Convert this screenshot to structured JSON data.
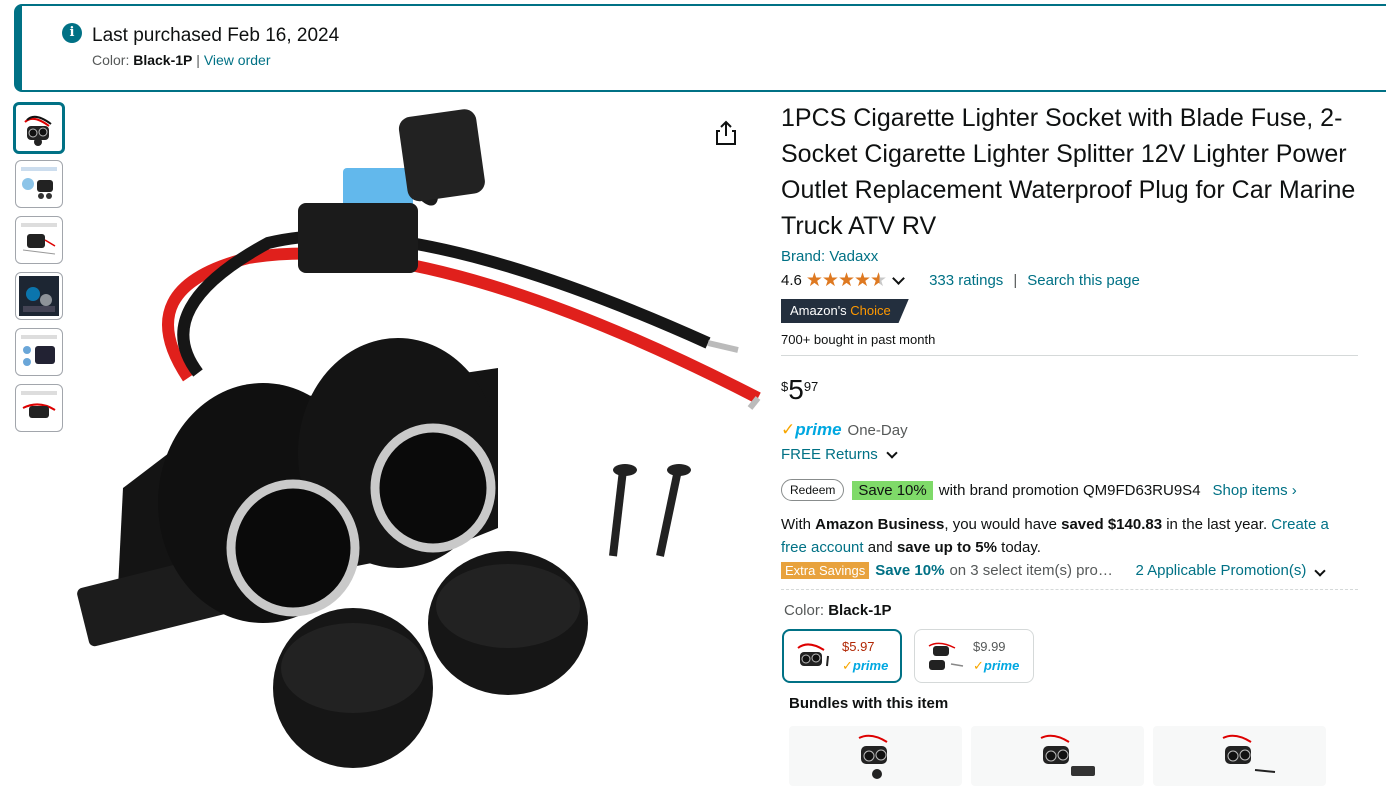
{
  "banner": {
    "title": "Last purchased Feb 16, 2024",
    "color_prefix": "Color: ",
    "color_value": "Black-1P",
    "separator": " | ",
    "view_order": "View order"
  },
  "product": {
    "title": "1PCS Cigarette Lighter Socket with Blade Fuse, 2-Socket Cigarette Lighter Splitter 12V Lighter Power Outlet Replacement Waterproof Plug for Car Marine Truck ATV RV",
    "brand": "Brand: Vadaxx",
    "rating": "4.6",
    "stars": 4.6,
    "ratings_count": "333 ratings",
    "rating_sep": "|",
    "search_page": "Search this page",
    "choice_prefix": "Amazon's",
    "choice_suffix": " Choice",
    "bought": "700+ bought in past month",
    "price_symbol": "$",
    "price_whole": "5",
    "price_fraction": "97",
    "prime_check": "✓",
    "prime_word": "prime",
    "one_day": "One-Day",
    "free_returns": "FREE Returns",
    "redeem": "Redeem",
    "save_badge": "Save 10%",
    "promo_text": "with brand promotion QM9FD63RU9S4",
    "shop_items": "Shop items ›",
    "biz_1": "With ",
    "biz_2": "Amazon Business",
    "biz_3": ", you would have ",
    "biz_4": "saved $140.83",
    "biz_5": " in the last year. ",
    "biz_6": "Create a free account",
    "biz_7": " and ",
    "biz_8": "save up to 5%",
    "biz_9": " today.",
    "extra_savings": "Extra Savings",
    "extra_save": "Save 10%",
    "extra_desc": "on 3 select item(s) pro…",
    "applicable": "2 Applicable Promotion(s)",
    "color_label": "Color: ",
    "color_value": "Black-1P",
    "swatches": [
      {
        "price": "$5.97",
        "prime": "prime"
      },
      {
        "price": "$9.99",
        "prime": "prime"
      }
    ],
    "bundles_title": "Bundles with this item"
  },
  "colors": {
    "accent": "#007185",
    "star": "#de7921",
    "prime": "#00a8e1",
    "save_green": "#7fda69",
    "extra_orange": "#e8a23d",
    "choice_bg": "#232f3e"
  },
  "icons": [
    "info-icon",
    "share-icon",
    "chevron-down-icon",
    "star-icon"
  ]
}
